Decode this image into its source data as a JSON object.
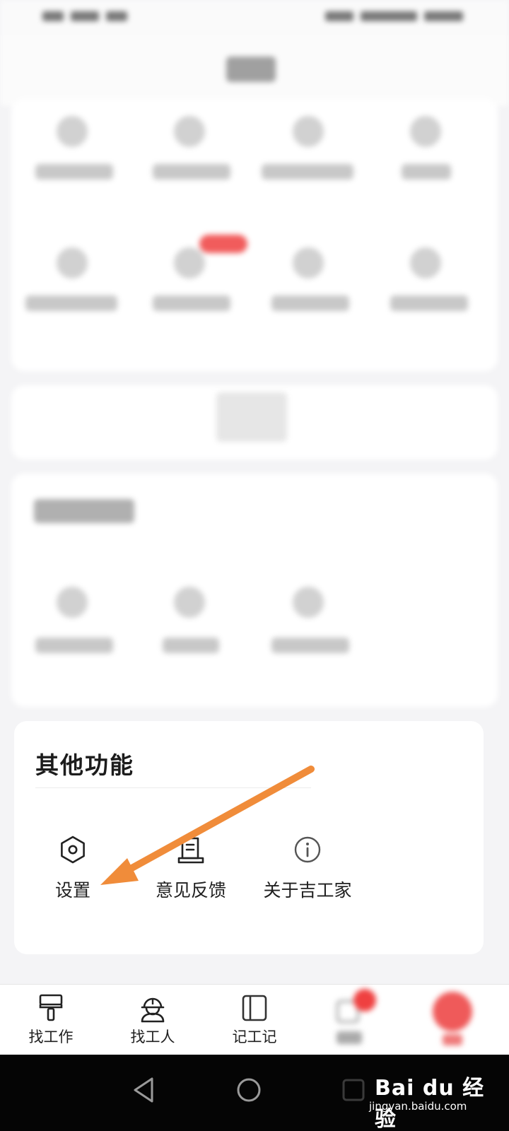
{
  "other_functions": {
    "title": "其他功能",
    "items": [
      {
        "label": "设置",
        "icon": "settings-hex-icon"
      },
      {
        "label": "意见反馈",
        "icon": "feedback-scroll-icon"
      },
      {
        "label": "关于吉工家",
        "icon": "info-icon"
      }
    ]
  },
  "tabbar": {
    "items": [
      {
        "label": "找工作",
        "icon": "paint-roller-icon"
      },
      {
        "label": "找工人",
        "icon": "worker-helmet-icon"
      },
      {
        "label": "记工记",
        "icon": "notebook-icon"
      }
    ]
  },
  "annotation": {
    "arrow_color": "#f08c3a"
  },
  "watermark": {
    "logo": "Bai du 经验",
    "url": "jingyan.baidu.com"
  },
  "colors": {
    "badge_red": "#ef4040",
    "arrow_orange": "#f08c3a"
  }
}
